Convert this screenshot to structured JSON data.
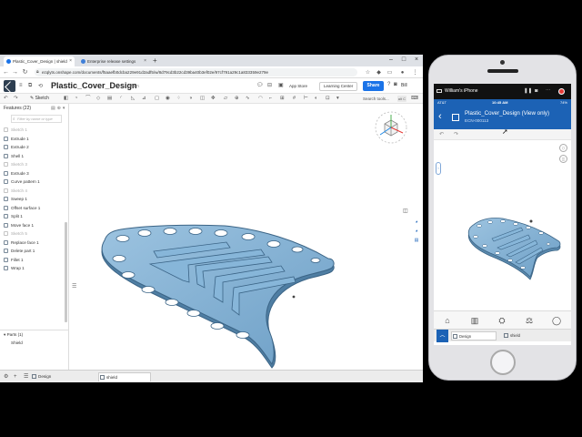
{
  "colors": {
    "onshape_blue": "#1a73e8",
    "mobile_header": "#1c62b5",
    "part_face": "#7fb0d4",
    "part_edge": "#4c7ea6",
    "part_hole": "#ffffff"
  },
  "browser": {
    "tabs": [
      {
        "label": "Plastic_Cover_Design | shield"
      },
      {
        "label": "Enterprise release settings"
      }
    ],
    "new_tab_icon": "plus-icon",
    "window_controls": [
      "minimize-icon",
      "maximize-icon",
      "close-icon"
    ],
    "url": "ezqlyts.onshape.com/documents/f5aaefb0dcba229e91d2adf5/w/8d79cd3b22cd39ba40b3ef02e/97cf791a29c1a833359e279e"
  },
  "app": {
    "document_title": "Plastic_Cover_Design",
    "branch": "Main",
    "buttons": {
      "app_store": "App Store",
      "learning_center": "Learning Center",
      "share": "Share",
      "account": "Bill"
    },
    "toolbar": {
      "sketch_label": "Sketch",
      "search_placeholder": "Search tools...",
      "search_shortcut": "alt C"
    }
  },
  "features": {
    "header": "Features (22)",
    "filter_placeholder": "Filter by name or type",
    "items": [
      {
        "name": "Sketch 1",
        "dim": true
      },
      {
        "name": "Extrude 1",
        "dim": false
      },
      {
        "name": "Extrude 2",
        "dim": false
      },
      {
        "name": "Shell 1",
        "dim": false
      },
      {
        "name": "Sketch 3",
        "dim": true
      },
      {
        "name": "Extrude 3",
        "dim": false
      },
      {
        "name": "Curve pattern 1",
        "dim": false
      },
      {
        "name": "Sketch 4",
        "dim": true
      },
      {
        "name": "Sweep 1",
        "dim": false
      },
      {
        "name": "Offset surface 1",
        "dim": false
      },
      {
        "name": "Split 1",
        "dim": false
      },
      {
        "name": "Move face 1",
        "dim": false
      },
      {
        "name": "Sketch 5",
        "dim": true
      },
      {
        "name": "Replace face 1",
        "dim": false
      },
      {
        "name": "Delete part 1",
        "dim": false
      },
      {
        "name": "Fillet 1",
        "dim": false
      },
      {
        "name": "Wrap 1",
        "dim": false
      }
    ],
    "parts_header": "Parts (1)",
    "parts": [
      "Shield"
    ]
  },
  "bottom_tabs": [
    {
      "label": "Design",
      "active": false
    },
    {
      "label": "shield",
      "active": true
    }
  ],
  "phone": {
    "mirror_title": "William's iPhone",
    "status": {
      "carrier": "AT&T",
      "time": "10:45 AM",
      "battery": "74%"
    },
    "doc_title": "Plastic_Cover_Design (View only)",
    "doc_subtitle": "ECN-000113",
    "tab_icons": [
      "home-icon",
      "library-icon",
      "parts-icon",
      "balance-icon",
      "comment-icon"
    ],
    "doc_tabs": [
      {
        "label": "Design",
        "active": true
      },
      {
        "label": "shield",
        "active": false
      }
    ]
  }
}
